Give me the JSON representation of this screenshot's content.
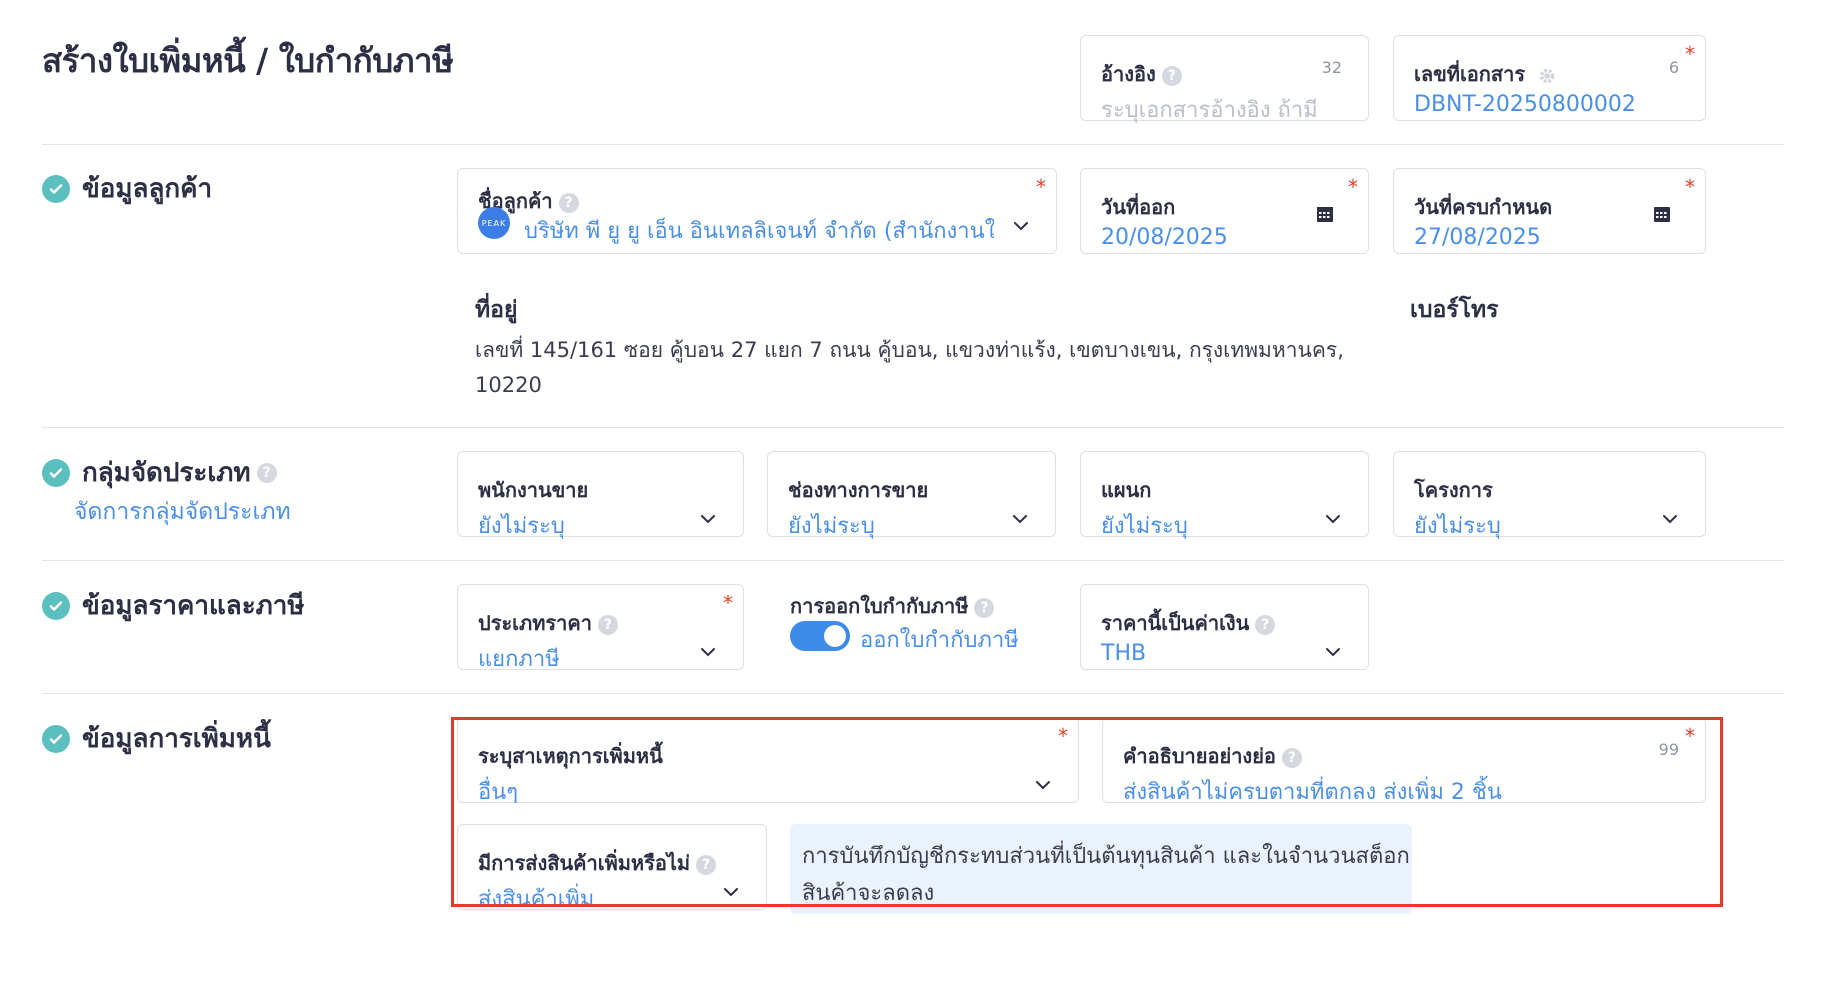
{
  "header": {
    "title": "สร้างใบเพิ่มหนี้ / ใบกำกับภาษี",
    "reference": {
      "label": "อ้างอิง",
      "counter": "32",
      "placeholder": "ระบุเอกสารอ้างอิง ถ้ามี"
    },
    "doc_number": {
      "label": "เลขที่เอกสาร",
      "counter": "6",
      "value": "DBNT-20250800002"
    }
  },
  "customer": {
    "section_title": "ข้อมูลลูกค้า",
    "name_label": "ชื่อลูกค้า",
    "avatar_text": "PEAK",
    "name_value": "บริษัท พี ยู ยู เอ็น อินเทลลิเจนท์ จำกัด (สำนักงานให...",
    "issue_date_label": "วันที่ออก",
    "issue_date": "20/08/2025",
    "due_date_label": "วันที่ครบกำหนด",
    "due_date": "27/08/2025",
    "address_label": "ที่อยู่",
    "address_line1": "เลขที่ 145/161 ซอย คู้บอน 27 แยก 7 ถนน คู้บอน, แขวงท่าแร้ง, เขตบางเขน, กรุงเทพมหานคร,",
    "address_line2": "10220",
    "phone_label": "เบอร์โทร"
  },
  "classification": {
    "section_title": "กลุ่มจัดประเภท",
    "manage_link": "จัดการกลุ่มจัดประเภท",
    "fields": [
      {
        "label": "พนักงานขาย",
        "value": "ยังไม่ระบุ"
      },
      {
        "label": "ช่องทางการขาย",
        "value": "ยังไม่ระบุ"
      },
      {
        "label": "แผนก",
        "value": "ยังไม่ระบุ"
      },
      {
        "label": "โครงการ",
        "value": "ยังไม่ระบุ"
      }
    ]
  },
  "pricing": {
    "section_title": "ข้อมูลราคาและภาษี",
    "price_type_label": "ประเภทราคา",
    "price_type_value": "แยกภาษี",
    "tax_invoice_label": "การออกใบกำกับภาษี",
    "tax_invoice_toggle_text": "ออกใบกำกับภาษี",
    "tax_invoice_on": true,
    "currency_label": "ราคานี้เป็นค่าเงิน",
    "currency_value": "THB"
  },
  "debit": {
    "section_title": "ข้อมูลการเพิ่มหนี้",
    "reason_label": "ระบุสาเหตุการเพิ่มหนี้",
    "reason_value": "อื่นๆ",
    "desc_label": "คำอธิบายอย่างย่อ",
    "desc_counter": "99",
    "desc_value": "ส่งสินค้าไม่ครบตามที่ตกลง ส่งเพิ่ม 2 ชิ้น",
    "extra_goods_label": "มีการส่งสินค้าเพิ่มหรือไม่",
    "extra_goods_value": "ส่งสินค้าเพิ่ม",
    "info_text": "การบันทึกบัญชีกระทบส่วนที่เป็นต้นทุนสินค้า และในจำนวนสต็อกสินค้าจะลดลง"
  },
  "colors": {
    "accent": "#4a8fe7",
    "check": "#5bbfc0",
    "required": "#e5402a",
    "highlight": "#e23d2c"
  }
}
